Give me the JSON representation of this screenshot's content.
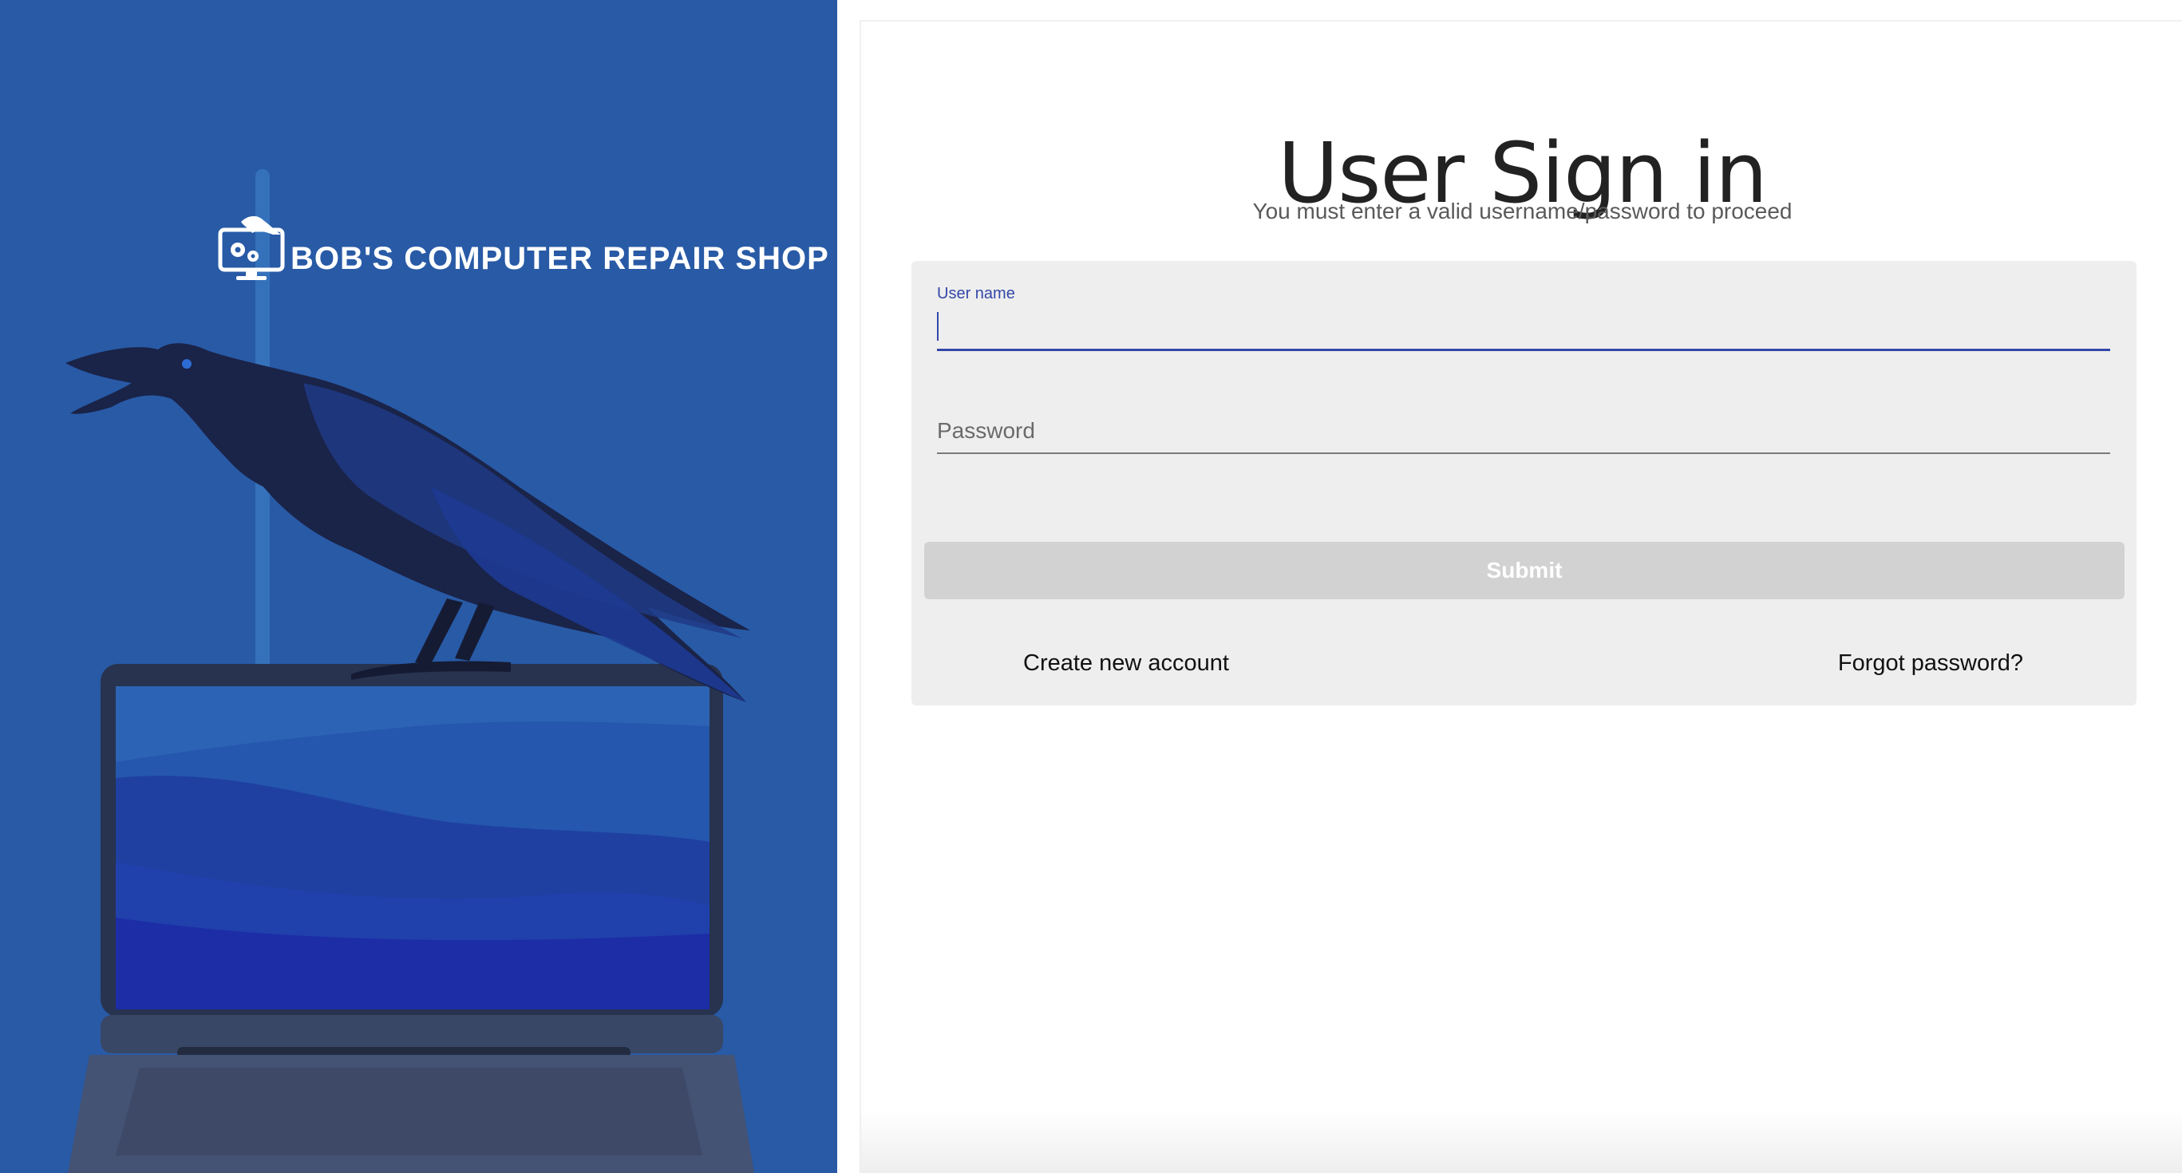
{
  "brand": {
    "name": "BOB'S COMPUTER REPAIR SHOP",
    "logo_icon": "computer-repair-logo-icon",
    "hero_image": "raven-on-laptop-illustration"
  },
  "signin": {
    "title": "User Sign in",
    "subtitle": "You must enter a valid username/password to proceed",
    "username": {
      "label": "User name",
      "value": ""
    },
    "password": {
      "placeholder": "Password",
      "value": ""
    },
    "submit_label": "Submit",
    "create_account_label": "Create new account",
    "forgot_password_label": "Forgot password?"
  },
  "colors": {
    "hero_background": "#285aa6",
    "accent": "#3447a8",
    "card_background": "#eeeeee",
    "submit_disabled": "#d2d2d2"
  }
}
